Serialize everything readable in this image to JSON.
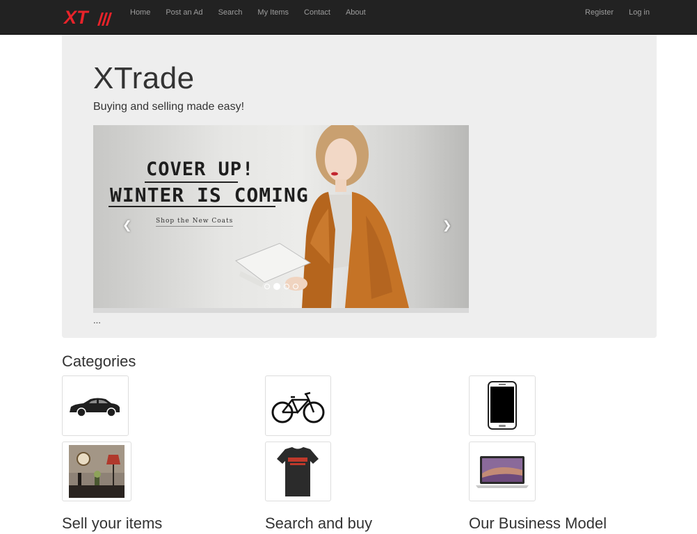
{
  "navbar": {
    "brand": "XT",
    "links": [
      "Home",
      "Post an Ad",
      "Search",
      "My Items",
      "Contact",
      "About"
    ],
    "right_links": [
      "Register",
      "Log in"
    ]
  },
  "jumbotron": {
    "title": "XTrade",
    "lead": "Buying and selling made easy!",
    "carousel": {
      "promo_line1": "COVER UP!",
      "promo_line2": "WINTER IS COMING",
      "promo_cta": "Shop the New Coats",
      "slide_count": 4,
      "active_slide": 2
    },
    "caption": "..."
  },
  "categories": {
    "heading": "Categories",
    "items": [
      "car",
      "bicycle",
      "smartphone",
      "home-decor",
      "t-shirt",
      "laptop"
    ]
  },
  "sections": [
    "Sell your items",
    "Search and buy",
    "Our Business Model"
  ],
  "colors": {
    "navbar_bg": "#222222",
    "nav_link": "#9d9d9d",
    "jumbotron_bg": "#eeeeee",
    "brand_red": "#e8232a"
  }
}
